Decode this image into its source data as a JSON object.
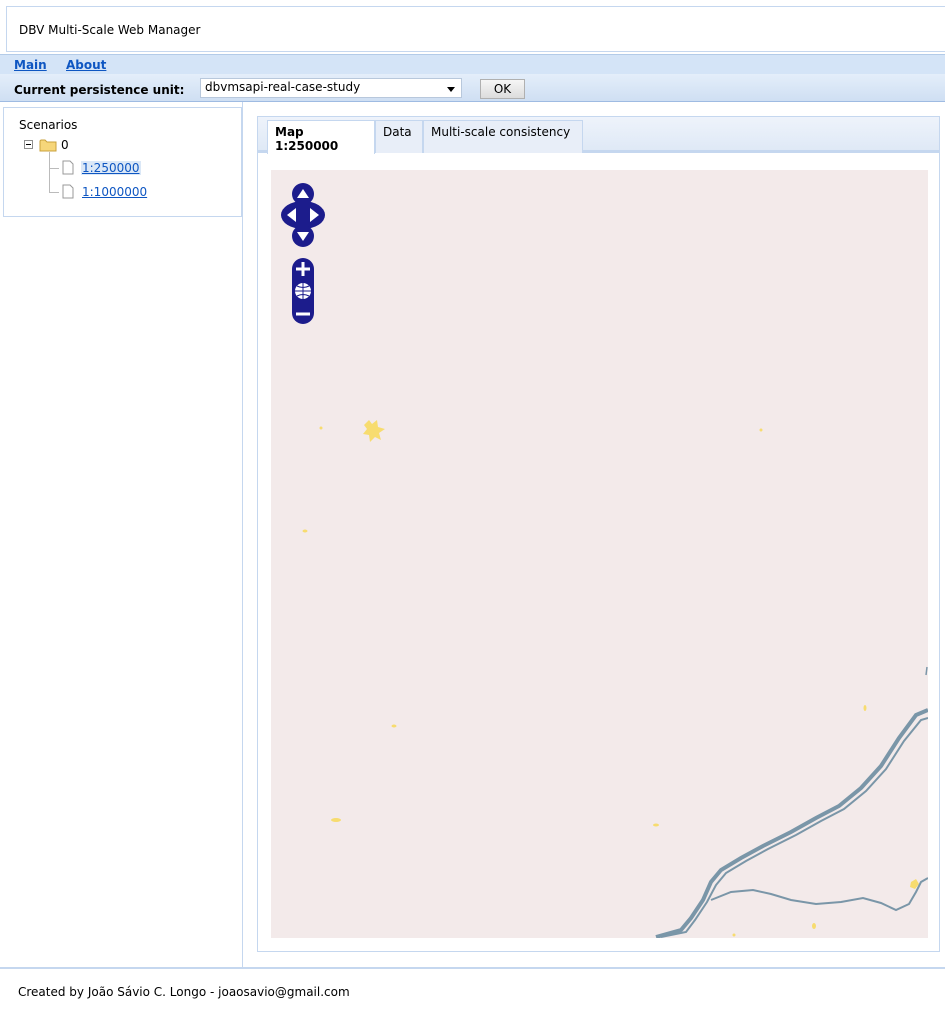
{
  "app": {
    "title": "DBV Multi-Scale Web Manager"
  },
  "menu": {
    "main": "Main",
    "about": "About"
  },
  "persistence": {
    "label": "Current persistence unit:",
    "selected": "dbvmsapi-real-case-study",
    "ok_label": "OK"
  },
  "tree": {
    "root": "Scenarios",
    "folder": "0",
    "leaves": [
      {
        "label": "1:250000",
        "selected": true
      },
      {
        "label": "1:1000000",
        "selected": false
      }
    ]
  },
  "tabs": [
    {
      "label": "Map 1:250000",
      "active": true
    },
    {
      "label": "Data",
      "active": false
    },
    {
      "label": "Multi-scale consistency",
      "active": false
    }
  ],
  "map": {
    "background": "#f3eaea",
    "river_color": "#7a96a8",
    "urban_color": "#f7dc6f",
    "control_color": "#1c1c8c"
  },
  "footer": {
    "text": "Created by João Sávio C. Longo - joaosavio@gmail.com"
  }
}
